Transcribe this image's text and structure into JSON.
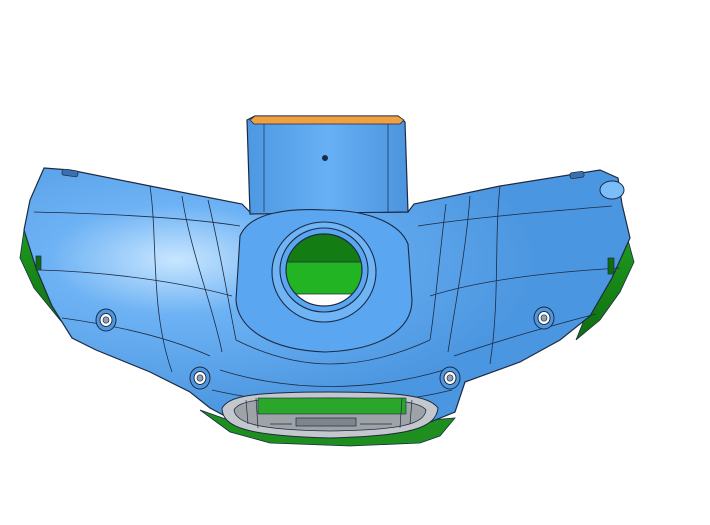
{
  "scene": {
    "background_color": "#ffffff",
    "colors": {
      "body_blue": "#5aa6f0",
      "body_blue_light": "#8fc6ff",
      "body_blue_dark": "#3f86cf",
      "edge_line": "#1d2a44",
      "inner_green": "#1f9a1f",
      "inner_green_dark": "#137013",
      "rim_orange": "#f0a040",
      "underside_gray": "#b8bcc0"
    },
    "model_parts": [
      "top-column",
      "left-wing",
      "right-wing",
      "center-lens-ring",
      "front-vent",
      "mount-holes"
    ]
  }
}
